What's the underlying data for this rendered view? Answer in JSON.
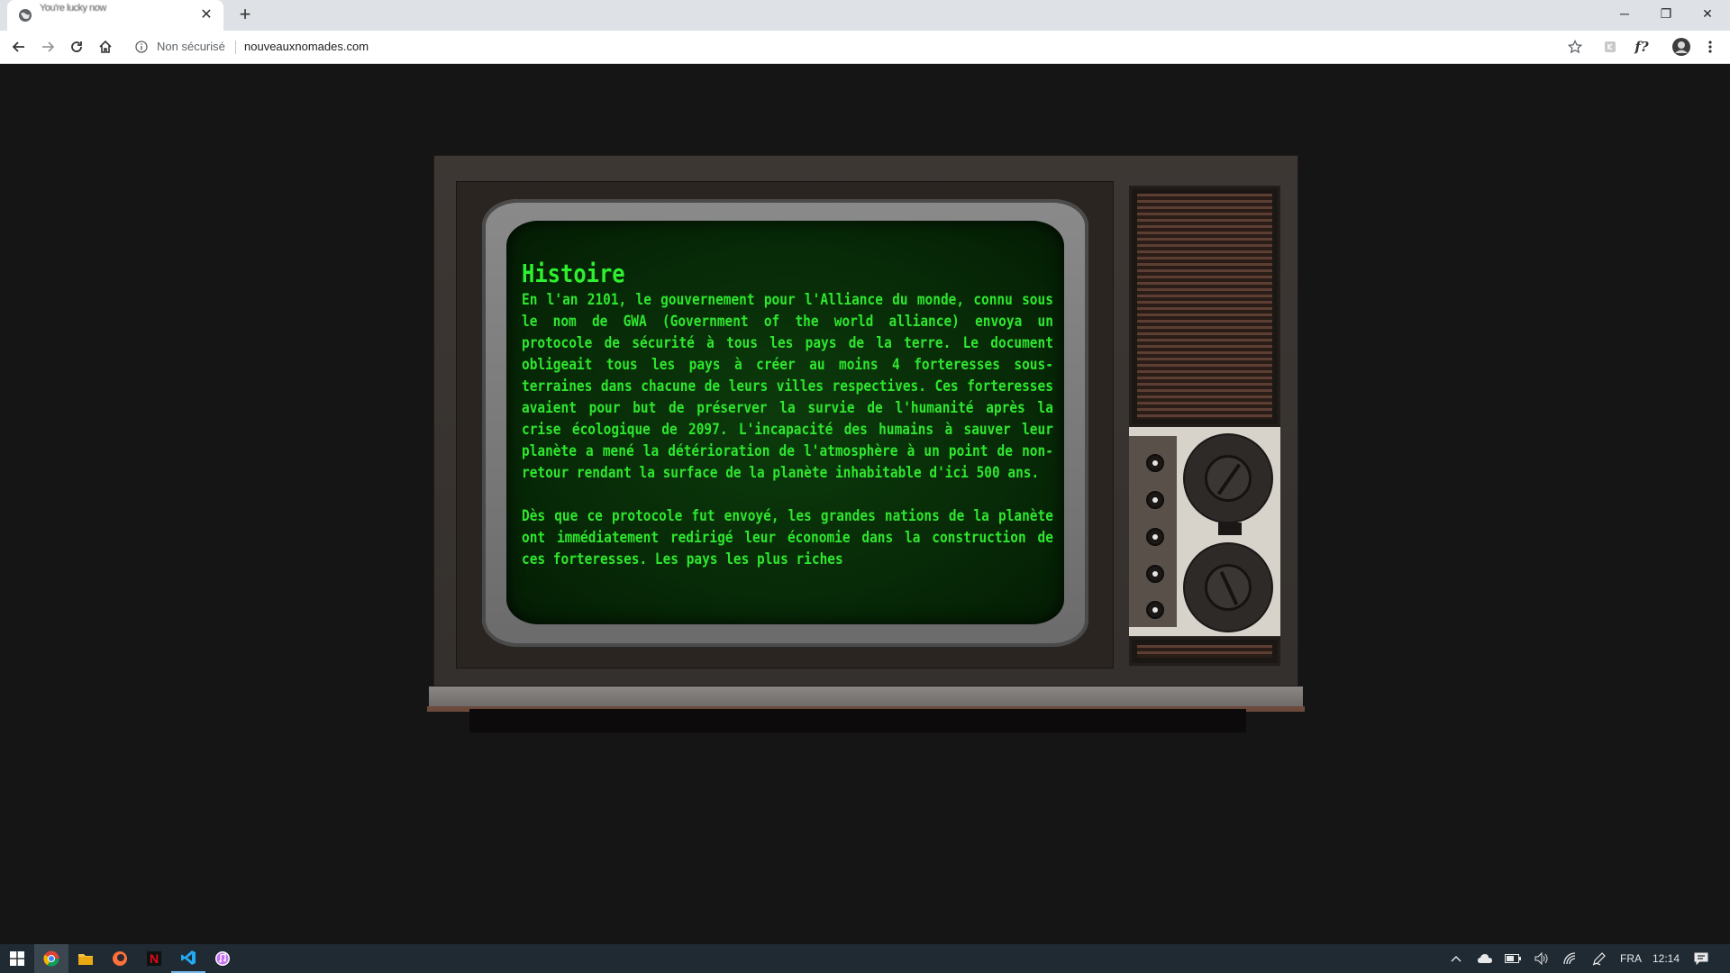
{
  "browser": {
    "tab": {
      "title": "You're lucky now",
      "close_symbol": "✕"
    },
    "new_tab_symbol": "+",
    "window_controls": {
      "minimize": "─",
      "restore": "❐",
      "close": "✕"
    },
    "security_label": "Non sécurisé",
    "url": "nouveauxnomades.com",
    "extension_label": "f?"
  },
  "tv_screen": {
    "title": "Histoire",
    "paragraphs": [
      "En l'an 2101, le gouvernement pour l'Alliance du monde, connu sous le nom de GWA (Government of the world alliance) envoya un protocole de sécurité à tous les pays de la terre. Le document obligeait tous les pays à créer au moins 4 forteresses sous-terraines dans chacune de leurs villes respectives. Ces forteresses avaient pour but de préserver la survie de l'humanité après la crise écologique de 2097. L'incapacité des humains à sauver leur planète a mené la détérioration de l'atmosphère à un point de non-retour rendant la surface de la planète inhabitable d'ici 500 ans.",
      "Dès que ce protocole fut envoyé, les grandes nations de la planète ont immédiatement redirigé leur économie dans la construction de ces forteresses. Les pays les plus riches"
    ]
  },
  "taskbar": {
    "apps": [
      "start-icon",
      "chrome-icon",
      "file-explorer-icon",
      "firefox-icon",
      "netflix-icon",
      "vscode-icon",
      "itunes-icon"
    ],
    "netflix_letter": "N",
    "language": "FRA",
    "time": "12:14"
  },
  "colors": {
    "screen_text": "#2ee62e",
    "page_background": "#151515",
    "taskbar": "#1f2a33"
  }
}
